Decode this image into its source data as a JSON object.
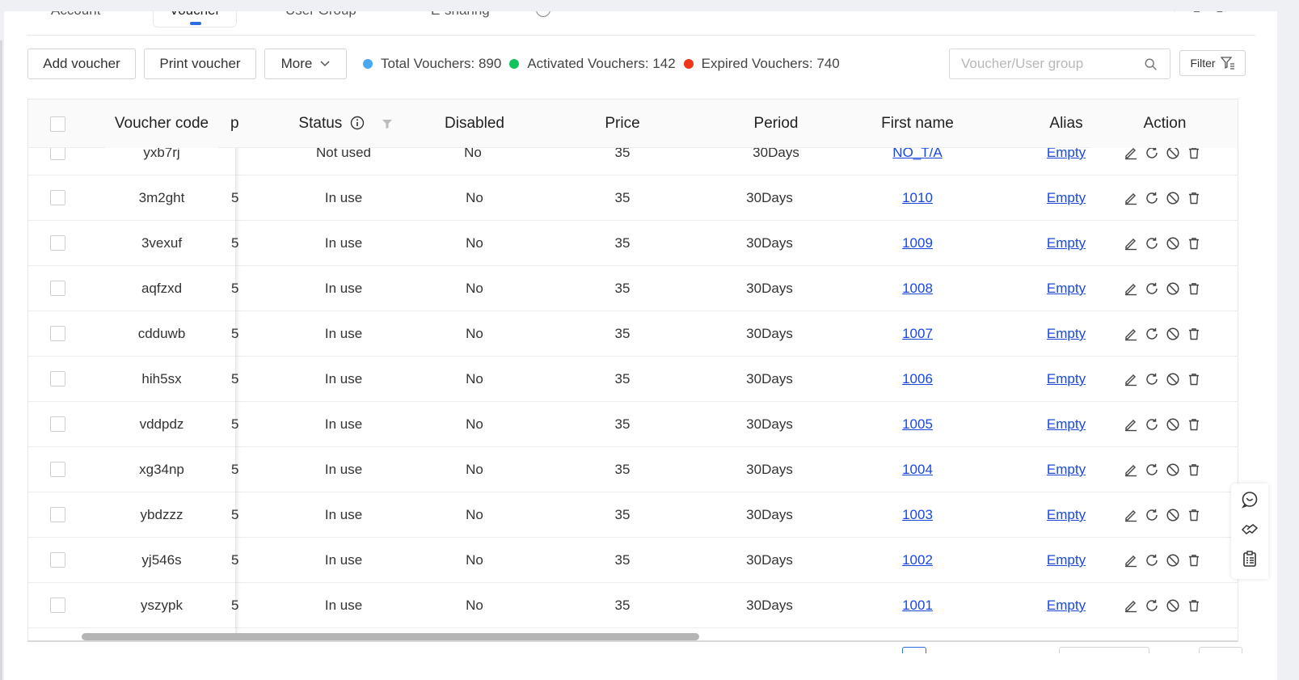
{
  "tabs": [
    {
      "label": "Account"
    },
    {
      "label": "Voucher"
    },
    {
      "label": "User Group"
    },
    {
      "label": "E-sharing"
    }
  ],
  "toolbar": {
    "add_label": "Add voucher",
    "print_label": "Print voucher",
    "more_label": "More",
    "stats": [
      {
        "label": "Total Vouchers: 890",
        "color": "#4aa8f0"
      },
      {
        "label": "Activated Vouchers: 142",
        "color": "#16c25c"
      },
      {
        "label": "Expired Vouchers: 740",
        "color": "#f0361a"
      }
    ],
    "search_placeholder": "Voucher/User group",
    "filter_label": "Filter"
  },
  "table": {
    "headers": {
      "voucher_code": "Voucher code",
      "group_partial": "p",
      "status": "Status",
      "disabled": "Disabled",
      "price": "Price",
      "period": "Period",
      "first_name": "First name",
      "alias": "Alias",
      "action": "Action"
    },
    "partial_row": {
      "code": "yxb7rj",
      "status": "Not used",
      "disabled": "No",
      "price": "35",
      "period": "30Days",
      "first_name": "NO_T/A",
      "alias": "Empty"
    },
    "rows": [
      {
        "code": "3m2ght",
        "group": "5",
        "status": "In use",
        "disabled": "No",
        "price": "35",
        "period": "30Days",
        "first_name": "1010",
        "alias": "Empty"
      },
      {
        "code": "3vexuf",
        "group": "5",
        "status": "In use",
        "disabled": "No",
        "price": "35",
        "period": "30Days",
        "first_name": "1009",
        "alias": "Empty"
      },
      {
        "code": "aqfzxd",
        "group": "5",
        "status": "In use",
        "disabled": "No",
        "price": "35",
        "period": "30Days",
        "first_name": "1008",
        "alias": "Empty"
      },
      {
        "code": "cdduwb",
        "group": "5",
        "status": "In use",
        "disabled": "No",
        "price": "35",
        "period": "30Days",
        "first_name": "1007",
        "alias": "Empty"
      },
      {
        "code": "hih5sx",
        "group": "5",
        "status": "In use",
        "disabled": "No",
        "price": "35",
        "period": "30Days",
        "first_name": "1006",
        "alias": "Empty"
      },
      {
        "code": "vddpdz",
        "group": "5",
        "status": "In use",
        "disabled": "No",
        "price": "35",
        "period": "30Days",
        "first_name": "1005",
        "alias": "Empty"
      },
      {
        "code": "xg34np",
        "group": "5",
        "status": "In use",
        "disabled": "No",
        "price": "35",
        "period": "30Days",
        "first_name": "1004",
        "alias": "Empty"
      },
      {
        "code": "ybdzzz",
        "group": "5",
        "status": "In use",
        "disabled": "No",
        "price": "35",
        "period": "30Days",
        "first_name": "1003",
        "alias": "Empty"
      },
      {
        "code": "yj546s",
        "group": "5",
        "status": "In use",
        "disabled": "No",
        "price": "35",
        "period": "30Days",
        "first_name": "1002",
        "alias": "Empty"
      },
      {
        "code": "yszypk",
        "group": "5",
        "status": "In use",
        "disabled": "No",
        "price": "35",
        "period": "30Days",
        "first_name": "1001",
        "alias": "Empty"
      }
    ]
  },
  "icons": {
    "top": [
      "refresh-icon",
      "export-icon",
      "layout-icon"
    ],
    "actions": [
      "edit-icon",
      "reset-icon",
      "disable-icon",
      "delete-icon"
    ],
    "float": [
      "chat-icon",
      "handshake-icon",
      "clipboard-icon"
    ]
  },
  "colors": {
    "link": "#1a47e0",
    "accent": "#2b6de0"
  }
}
